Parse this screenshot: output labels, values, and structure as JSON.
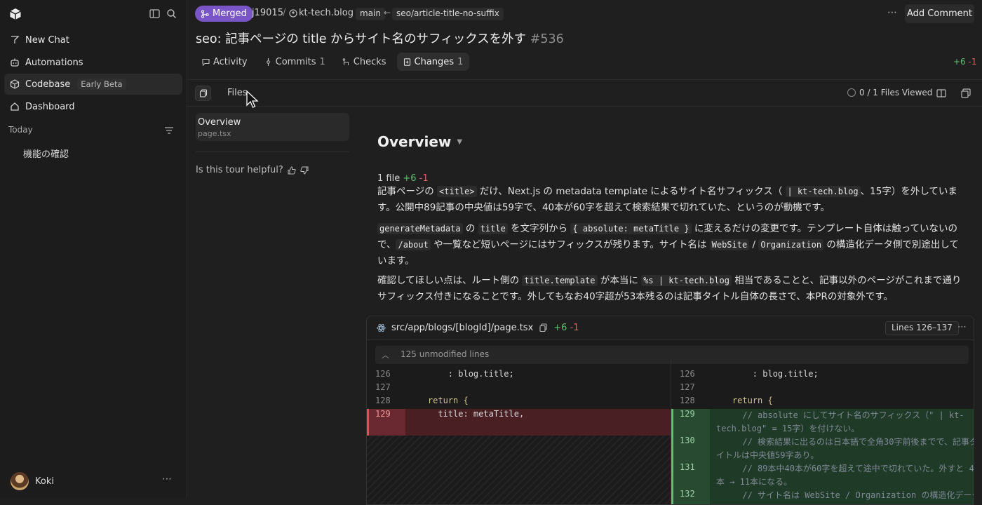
{
  "sidebar": {
    "nav": [
      {
        "label": "New Chat",
        "icon": "chat-icon"
      },
      {
        "label": "Automations",
        "icon": "robot-icon"
      },
      {
        "label": "Codebase",
        "icon": "cube-icon",
        "badge": "Early Beta"
      },
      {
        "label": "Dashboard",
        "icon": "home-icon"
      }
    ],
    "section": "Today",
    "chats": [
      "機能の確認"
    ],
    "user": "Koki"
  },
  "header": {
    "status": "Merged",
    "org": "j19015",
    "sep": "/",
    "repo": "kt-tech.blog",
    "base": "main",
    "head": "seo/article-title-no-suffix",
    "add_comment": "Add Comment",
    "title": "seo: 記事ページの title からサイト名のサフィックスを外す",
    "number": "#536"
  },
  "tabs": [
    {
      "label": "Activity",
      "count": ""
    },
    {
      "label": "Commits",
      "count": "1"
    },
    {
      "label": "Checks",
      "count": ""
    },
    {
      "label": "Changes",
      "count": "1"
    }
  ],
  "stats": {
    "add": "+6",
    "del": "-1"
  },
  "toolbar": {
    "files": "Files",
    "viewed": "0 / 1  Files Viewed"
  },
  "tour": {
    "item_title": "Overview",
    "item_sub": "page.tsx",
    "helpful": "Is this tour helpful?"
  },
  "overview": {
    "heading": "Overview",
    "file_count": "1 file",
    "file_add": "+6",
    "file_del": "-1",
    "p1": {
      "t1": "記事ページの ",
      "c1": "<title>",
      "t2": " だけ、Next.js の metadata template によるサイト名サフィックス（ ",
      "c2": " | kt-tech.blog",
      "t3": "、15字）を外しています。公開中89記事の中央値は59字で、40本が60字を超えて検索結果で切れていた、というのが動機です。"
    },
    "p2": {
      "c1": "generateMetadata",
      "t1": " の ",
      "c2": "title",
      "t2": " を文字列から ",
      "c3": "{ absolute: metaTitle }",
      "t3": " に変えるだけの変更です。テンプレート自体は触っていないので、",
      "c4": "/about",
      "t4": " や一覧など短いページにはサフィックスが残ります。サイト名は ",
      "c5": "WebSite",
      "t5": " / ",
      "c6": "Organization",
      "t6": " の構造化データ側で別途出しています。"
    },
    "p3": {
      "t1": "確認してほしい点は、ルート側の ",
      "c1": "title.template",
      "t2": " が本当に ",
      "c2": "%s | kt-tech.blog",
      "t3": " 相当であることと、記事以外のページがこれまで通りサフィックス付きになることです。外してもなお40字超が53本残るのは記事タイトル自体の長さで、本PRの対象外です。"
    }
  },
  "diff": {
    "path": "src/app/blogs/[blogId]/page.tsx",
    "add": "+6",
    "del": "-1",
    "lines_badge": "Lines 126–137",
    "unmodified": "125 unmodified lines",
    "left": [
      {
        "n": "126",
        "code": "        : blog.title;"
      },
      {
        "n": "127",
        "code": ""
      },
      {
        "n": "128",
        "code": "    return {"
      },
      {
        "n": "129",
        "code": "      title: metaTitle,"
      }
    ],
    "right": [
      {
        "n": "126",
        "code": "        : blog.title;"
      },
      {
        "n": "127",
        "code": ""
      },
      {
        "n": "128",
        "code": "    return {"
      },
      {
        "n": "129",
        "l1": "      // absolute にしてサイト名のサフィックス（\" | kt-",
        "l2": "tech.blog\" = 15字）を付けない。"
      },
      {
        "n": "130",
        "l1": "      // 検索結果に出るのは日本語で全角30字前後までで、記事タ",
        "l2": "イトルは中央値59字あり。"
      },
      {
        "n": "131",
        "l1": "      // 89本中40本が60字を超えて途中で切れていた。外すと 40",
        "l2": "本 → 11本になる。"
      },
      {
        "n": "132",
        "l1": "      // サイト名は WebSite / Organization の構造化データ"
      }
    ]
  }
}
